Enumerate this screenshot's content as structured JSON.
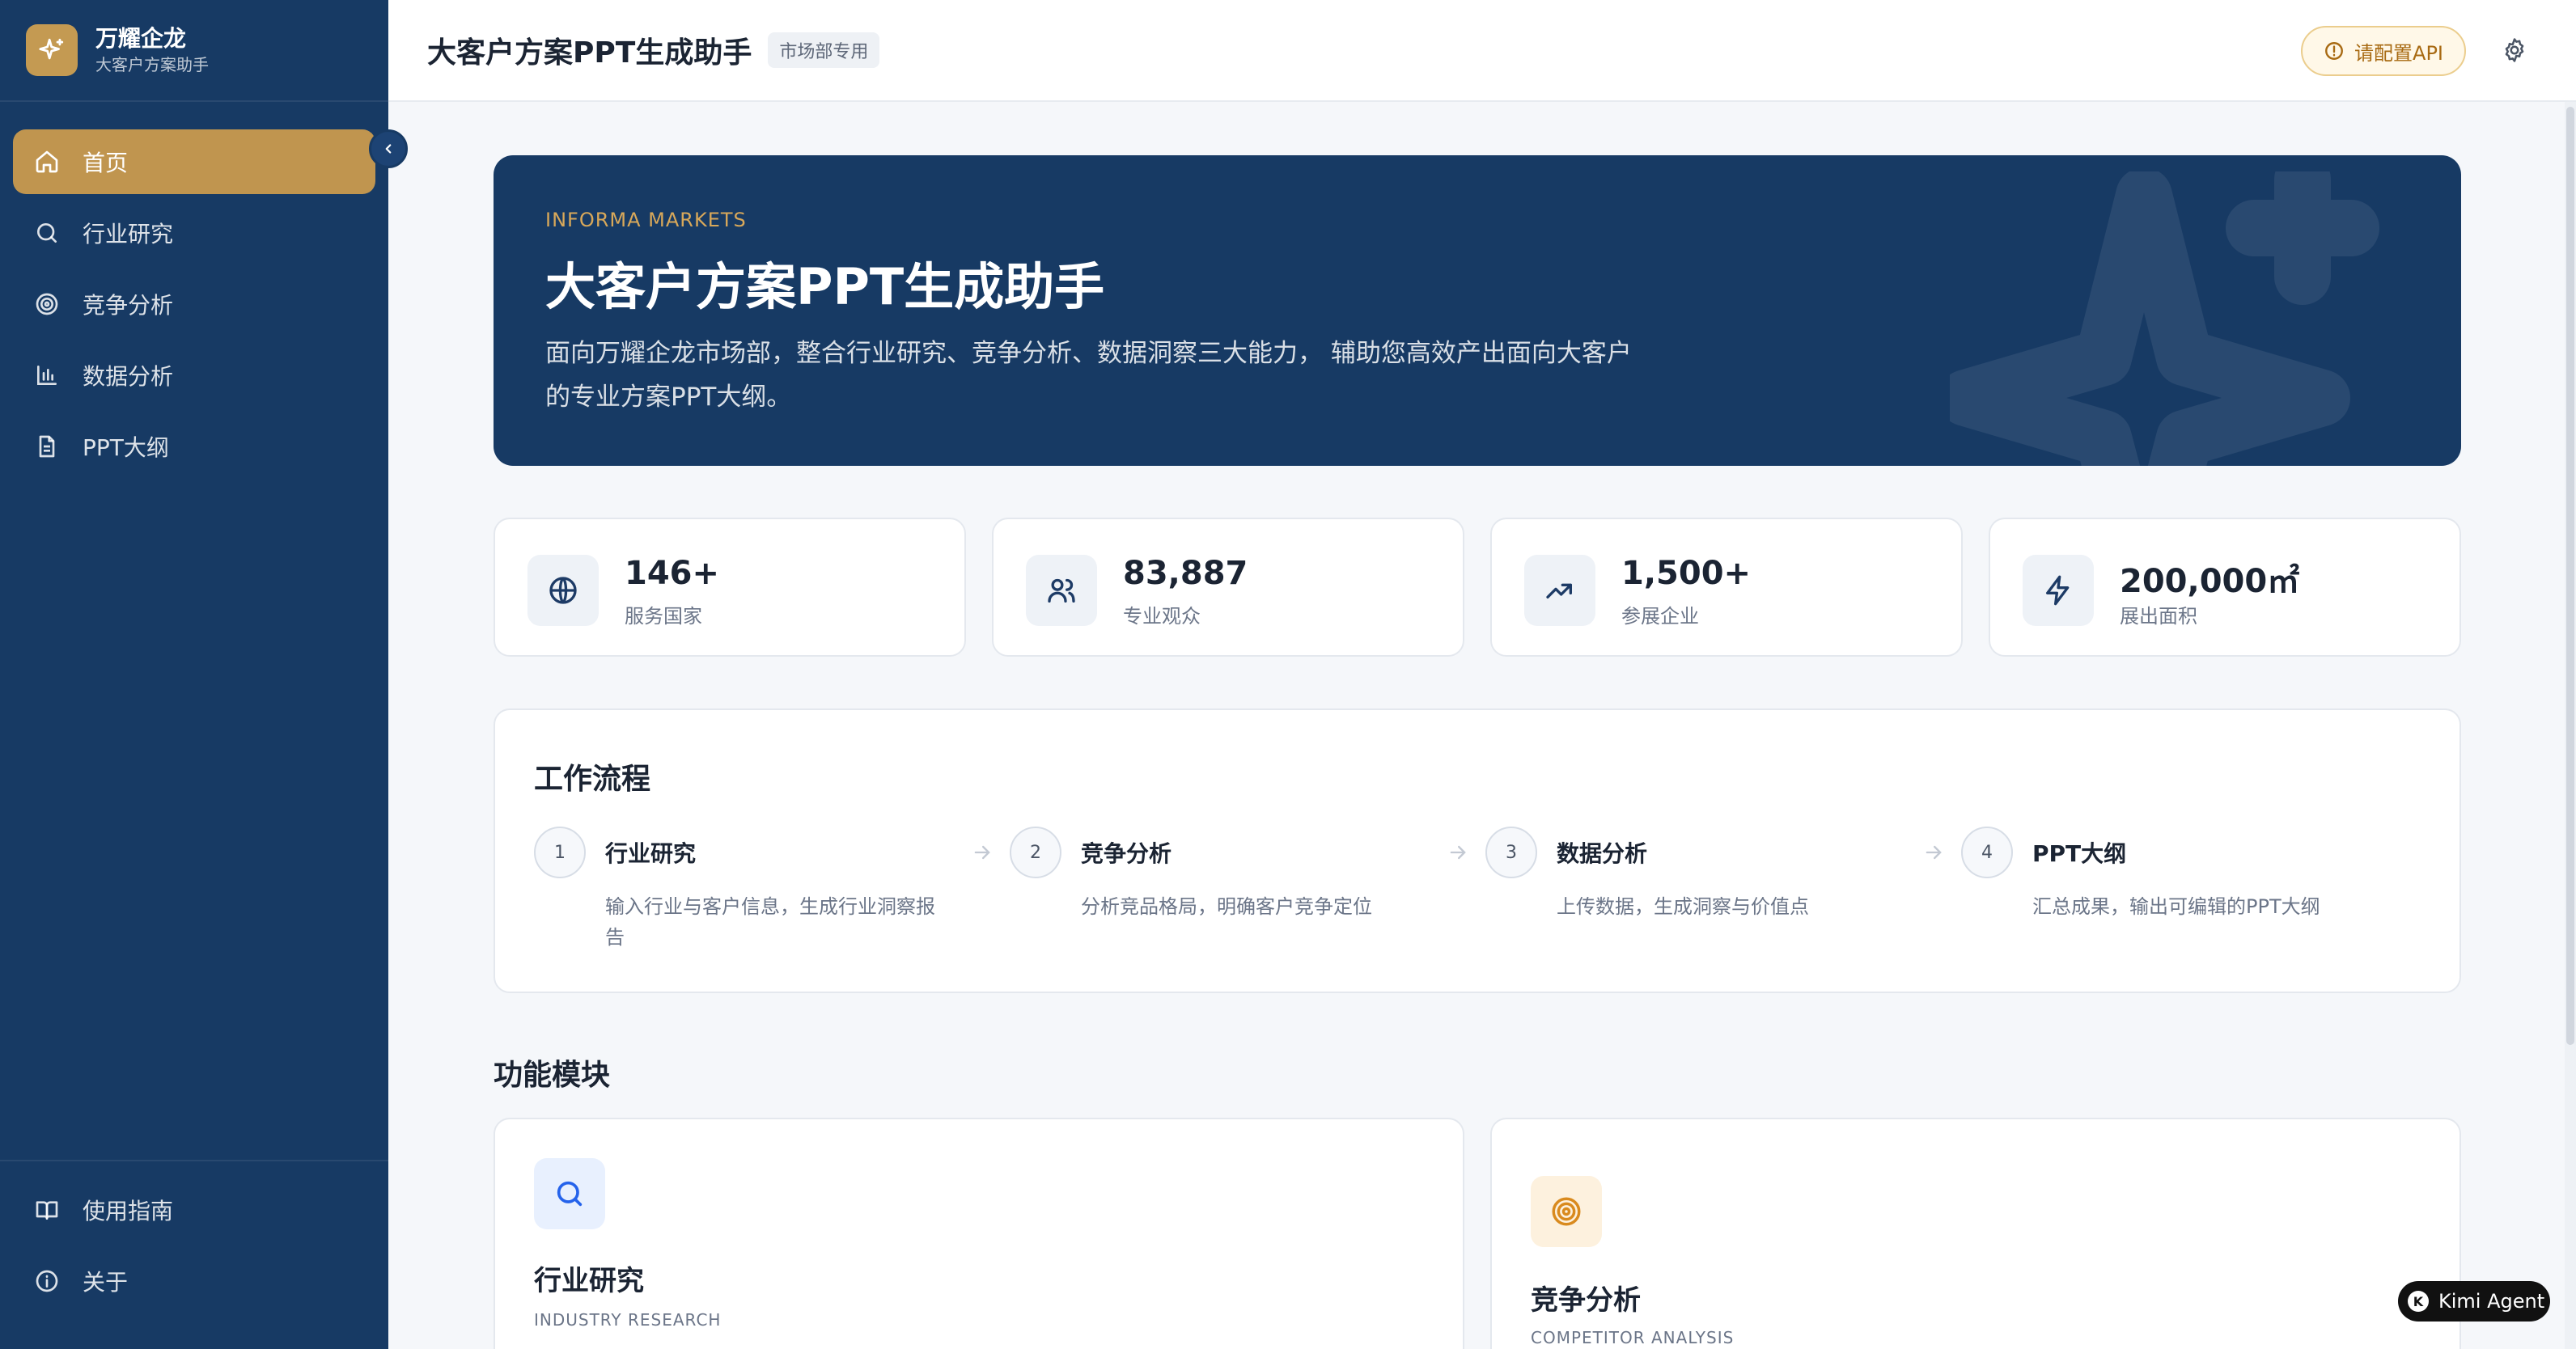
{
  "brand": {
    "name": "万耀企龙",
    "subtitle": "大客户方案助手",
    "logo_icon": "sparkle-icon"
  },
  "sidebar": {
    "items": [
      {
        "label": "首页",
        "icon": "home-icon",
        "active": true
      },
      {
        "label": "行业研究",
        "icon": "search-icon",
        "active": false
      },
      {
        "label": "竞争分析",
        "icon": "target-icon",
        "active": false
      },
      {
        "label": "数据分析",
        "icon": "bar-chart-icon",
        "active": false
      },
      {
        "label": "PPT大纲",
        "icon": "document-icon",
        "active": false
      }
    ],
    "bottom_items": [
      {
        "label": "使用指南",
        "icon": "book-icon"
      },
      {
        "label": "关于",
        "icon": "info-icon"
      }
    ]
  },
  "header": {
    "title": "大客户方案PPT生成助手",
    "badge": "市场部专用",
    "api_button": "请配置API"
  },
  "hero": {
    "eyebrow": "INFORMA MARKETS",
    "title": "大客户方案PPT生成助手",
    "description": "面向万耀企龙市场部，整合行业研究、竞争分析、数据洞察三大能力， 辅助您高效产出面向大客户的专业方案PPT大纲。"
  },
  "stats": [
    {
      "value": "146+",
      "label": "服务国家",
      "icon": "globe-icon"
    },
    {
      "value": "83,887",
      "label": "专业观众",
      "icon": "users-icon"
    },
    {
      "value": "1,500+",
      "label": "参展企业",
      "icon": "trending-up-icon"
    },
    {
      "value": "200,000㎡",
      "label": "展出面积",
      "icon": "lightning-icon"
    }
  ],
  "workflow": {
    "title": "工作流程",
    "steps": [
      {
        "num": "1",
        "title": "行业研究",
        "desc": "输入行业与客户信息，生成行业洞察报告"
      },
      {
        "num": "2",
        "title": "竞争分析",
        "desc": "分析竞品格局，明确客户竞争定位"
      },
      {
        "num": "3",
        "title": "数据分析",
        "desc": "上传数据，生成洞察与价值点"
      },
      {
        "num": "4",
        "title": "PPT大纲",
        "desc": "汇总成果，输出可编辑的PPT大纲"
      }
    ]
  },
  "modules": {
    "title": "功能模块",
    "items": [
      {
        "name": "行业研究",
        "en": "INDUSTRY RESEARCH",
        "icon": "search-icon",
        "accent": "#2563eb"
      },
      {
        "name": "竞争分析",
        "en": "COMPETITOR ANALYSIS",
        "icon": "target-icon",
        "accent": "#d98a1e"
      }
    ]
  },
  "agent_pill": {
    "label": "Kimi Agent",
    "initial": "K"
  },
  "colors": {
    "sidebar": "#173a64",
    "accent_gold": "#c0954f",
    "background": "#f5f7fa"
  }
}
